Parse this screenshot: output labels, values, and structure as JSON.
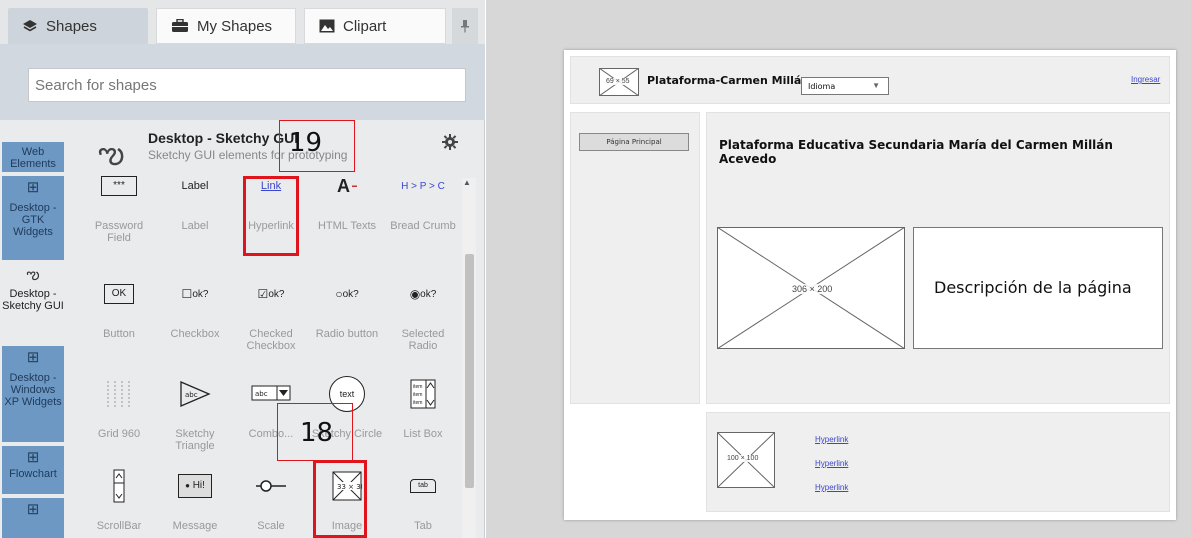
{
  "tabs": [
    {
      "label": "Shapes",
      "icon": "layers-icon"
    },
    {
      "label": "My Shapes",
      "icon": "briefcase-icon"
    },
    {
      "label": "Clipart",
      "icon": "image-icon"
    }
  ],
  "search": {
    "placeholder": "Search for shapes"
  },
  "categories": [
    {
      "label": "Web Elements"
    },
    {
      "label": "Desktop - GTK Widgets"
    },
    {
      "label": "Desktop - Sketchy GUI"
    },
    {
      "label": "Desktop - Windows XP Widgets"
    },
    {
      "label": "Flowchart"
    }
  ],
  "library": {
    "title": "Desktop - Sketchy GUI",
    "subtitle": "Sketchy GUI elements for prototyping"
  },
  "shapes": [
    {
      "label": "Password Field",
      "glyph": "***"
    },
    {
      "label": "Label",
      "glyph": "Label"
    },
    {
      "label": "Hyperlink",
      "glyph": "Link"
    },
    {
      "label": "HTML Texts",
      "glyph": "A"
    },
    {
      "label": "Bread Crumb",
      "glyph": "H > P > C"
    },
    {
      "label": "Button",
      "glyph": "OK"
    },
    {
      "label": "Checkbox",
      "glyph": "ok?"
    },
    {
      "label": "Checked Checkbox",
      "glyph": "ok?"
    },
    {
      "label": "Radio button",
      "glyph": "ok?"
    },
    {
      "label": "Selected Radio",
      "glyph": "ok?"
    },
    {
      "label": "Grid 960",
      "glyph": ""
    },
    {
      "label": "Sketchy Triangle",
      "glyph": "abc"
    },
    {
      "label": "Combo...",
      "glyph": "abc"
    },
    {
      "label": "Sketchy Circle",
      "glyph": "text"
    },
    {
      "label": "List Box",
      "glyph": "item"
    },
    {
      "label": "ScrollBar",
      "glyph": ""
    },
    {
      "label": "Message",
      "glyph": "Hi!"
    },
    {
      "label": "Scale",
      "glyph": ""
    },
    {
      "label": "Image",
      "glyph": "33 × 30"
    },
    {
      "label": "Tab",
      "glyph": "tab"
    }
  ],
  "annotations": {
    "a19": "19",
    "a18": "18"
  },
  "mock": {
    "logo_placeholder": "69 × 55",
    "site_title": "Plataforma-Carmen Millán",
    "language_select": "Idioma",
    "login_link": "Ingresar",
    "nav_button": "Página Principal",
    "heading": "Plataforma Educativa Secundaria María del Carmen Millán Acevedo",
    "main_image": "306 × 200",
    "description": "Descripción de la página",
    "footer_image": "100 × 100",
    "footer_links": [
      "Hyperlink",
      "Hyperlink",
      "Hyperlink"
    ]
  },
  "colors": {
    "accent": "#6d98c4",
    "annotation": "#e0141c",
    "link": "#3b46c9"
  }
}
